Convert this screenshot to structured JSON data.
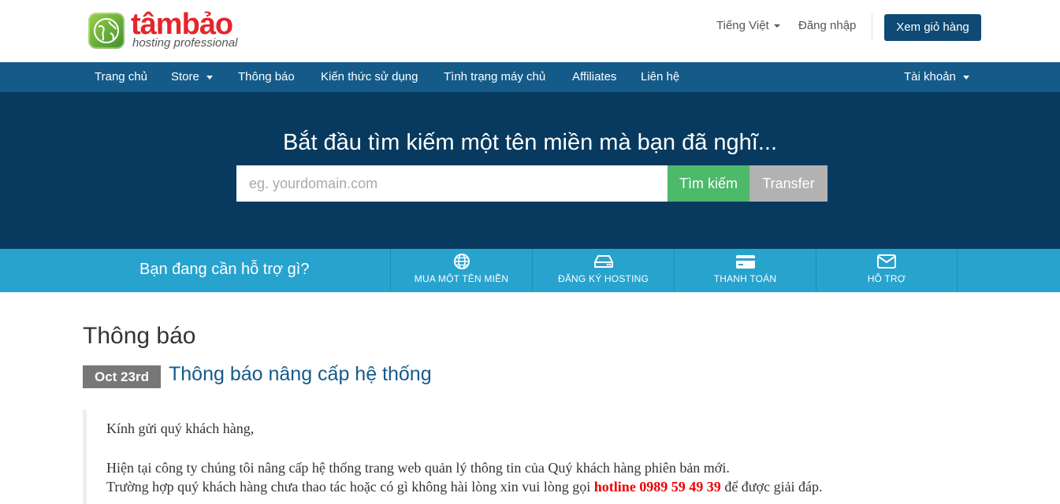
{
  "header": {
    "logo_word": "tâmbảo",
    "logo_tagline": "hosting professional",
    "language": "Tiếng Việt",
    "login": "Đăng nhập",
    "cart_button": "Xem giỏ hàng"
  },
  "nav": {
    "items": [
      "Trang chủ",
      "Store",
      "Thông báo",
      "Kiến thức sử dụng",
      "Tình trạng máy chủ",
      "Affiliates",
      "Liên hệ"
    ],
    "account": "Tài khoản"
  },
  "hero": {
    "title": "Bắt đầu tìm kiếm một tên miền mà bạn đã nghĩ...",
    "placeholder": "eg. yourdomain.com",
    "search_button": "Tìm kiếm",
    "transfer_button": "Transfer"
  },
  "helpbar": {
    "question": "Bạn đang cần hỗ trợ gì?",
    "items": [
      {
        "label": "MUA MỘT TÊN MIỀN",
        "icon": "globe-icon"
      },
      {
        "label": "ĐĂNG KÝ HOSTING",
        "icon": "hard-drive-icon"
      },
      {
        "label": "THANH TOÁN",
        "icon": "credit-card-icon"
      },
      {
        "label": "HỖ TRỢ",
        "icon": "envelope-icon"
      }
    ]
  },
  "content": {
    "page_title": "Thông báo",
    "date": "Oct 23rd",
    "post_title": "Thông báo nâng cấp hệ thống",
    "greeting": "Kính gửi quý khách hàng,",
    "line1": "Hiện tại công ty chúng tôi nâng cấp hệ thống trang web quản lý thông tin của Quý khách hàng phiên bản mới.",
    "line2_pre": "Trường hợp quý khách hàng chưa thao tác hoặc có gì không hài lòng xin vui lòng gọi ",
    "hotline": "hotline 0989 59 49 39",
    "line2_post": " để được giải đáp."
  },
  "colors": {
    "nav": "#145b8a",
    "hero": "#073a5e",
    "helpbar": "#27a3ce",
    "search": "#4cb96b",
    "transfer": "#b2b2b2",
    "hotline": "#ee0000"
  }
}
